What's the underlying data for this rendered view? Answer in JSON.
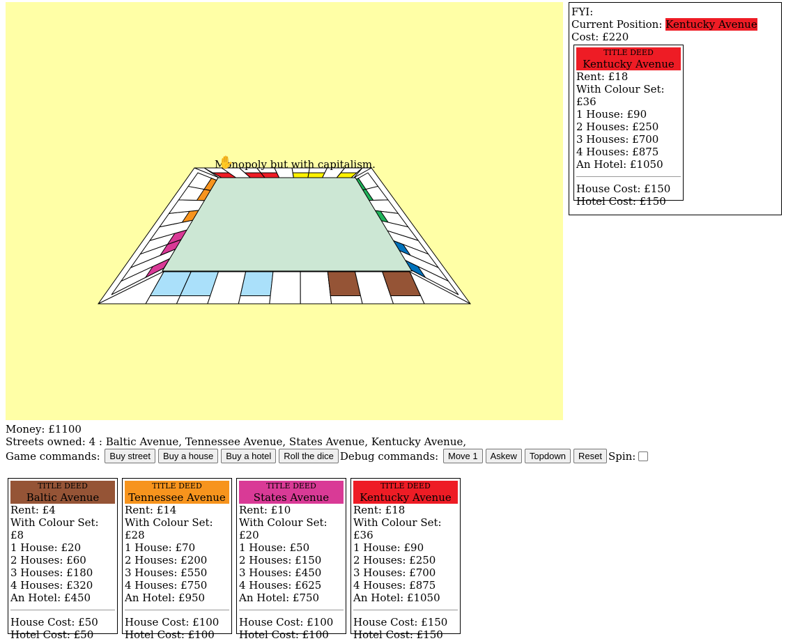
{
  "board": {
    "caption": "Monopoly but with capitalism.",
    "token_icon": "✋",
    "background": "#ffffa6",
    "center_color": "#cce7d4",
    "groups": {
      "brown": "#955436",
      "lightblue": "#aae0fa",
      "pink": "#d93a96",
      "orange": "#f7941d",
      "red": "#ee1c25",
      "yellow": "#fef200",
      "green": "#1fb25a",
      "blue": "#0072bb"
    }
  },
  "fyi": {
    "heading": "FYI:",
    "position_label": "Current Position:",
    "position_value": "Kentucky Avenue",
    "cost_label": "Cost:",
    "cost_value": "£220",
    "deed": {
      "title_deed": "TITLE DEED",
      "name": "Kentucky Avenue",
      "color": "#ee1c25",
      "rent": "Rent: £18",
      "colour_set": "With Colour Set: £36",
      "h1": "1 House: £90",
      "h2": "2 Houses: £250",
      "h3": "3 Houses: £700",
      "h4": "4 Houses: £875",
      "hotel": "An Hotel: £1050",
      "house_cost": "House Cost: £150",
      "hotel_cost": "Hotel Cost: £150"
    }
  },
  "status": {
    "money_label": "Money:",
    "money_value": "£1100",
    "streets_label": "Streets owned:",
    "streets_value": "4 : Baltic Avenue, Tennessee Avenue, States Avenue, Kentucky Avenue,"
  },
  "commands": {
    "game_label": "Game commands:",
    "buy_street": "Buy street",
    "buy_house": "Buy a house",
    "buy_hotel": "Buy a hotel",
    "roll_dice": "Roll the dice",
    "debug_label": "Debug commands:",
    "move1": "Move 1",
    "askew": "Askew",
    "topdown": "Topdown",
    "reset": "Reset",
    "spin_label": "Spin:",
    "spin_checked": false
  },
  "owned_cards": [
    {
      "title_deed": "TITLE DEED",
      "name": "Baltic Avenue",
      "color": "#955436",
      "rent": "Rent: £4",
      "colour_set": "With Colour Set: £8",
      "h1": "1 House: £20",
      "h2": "2 Houses: £60",
      "h3": "3 Houses: £180",
      "h4": "4 Houses: £320",
      "hotel": "An Hotel: £450",
      "house_cost": "House Cost: £50",
      "hotel_cost": "Hotel Cost: £50"
    },
    {
      "title_deed": "TITLE DEED",
      "name": "Tennessee Avenue",
      "color": "#f7941d",
      "rent": "Rent: £14",
      "colour_set": "With Colour Set: £28",
      "h1": "1 House: £70",
      "h2": "2 Houses: £200",
      "h3": "3 Houses: £550",
      "h4": "4 Houses: £750",
      "hotel": "An Hotel: £950",
      "house_cost": "House Cost: £100",
      "hotel_cost": "Hotel Cost: £100"
    },
    {
      "title_deed": "TITLE DEED",
      "name": "States Avenue",
      "color": "#d93a96",
      "rent": "Rent: £10",
      "colour_set": "With Colour Set: £20",
      "h1": "1 House: £50",
      "h2": "2 Houses: £150",
      "h3": "3 Houses: £450",
      "h4": "4 Houses: £625",
      "hotel": "An Hotel: £750",
      "house_cost": "House Cost: £100",
      "hotel_cost": "Hotel Cost: £100"
    },
    {
      "title_deed": "TITLE DEED",
      "name": "Kentucky Avenue",
      "color": "#ee1c25",
      "rent": "Rent: £18",
      "colour_set": "With Colour Set: £36",
      "h1": "1 House: £90",
      "h2": "2 Houses: £250",
      "h3": "3 Houses: £700",
      "h4": "4 Houses: £875",
      "hotel": "An Hotel: £1050",
      "house_cost": "House Cost: £150",
      "hotel_cost": "Hotel Cost: £150"
    }
  ]
}
